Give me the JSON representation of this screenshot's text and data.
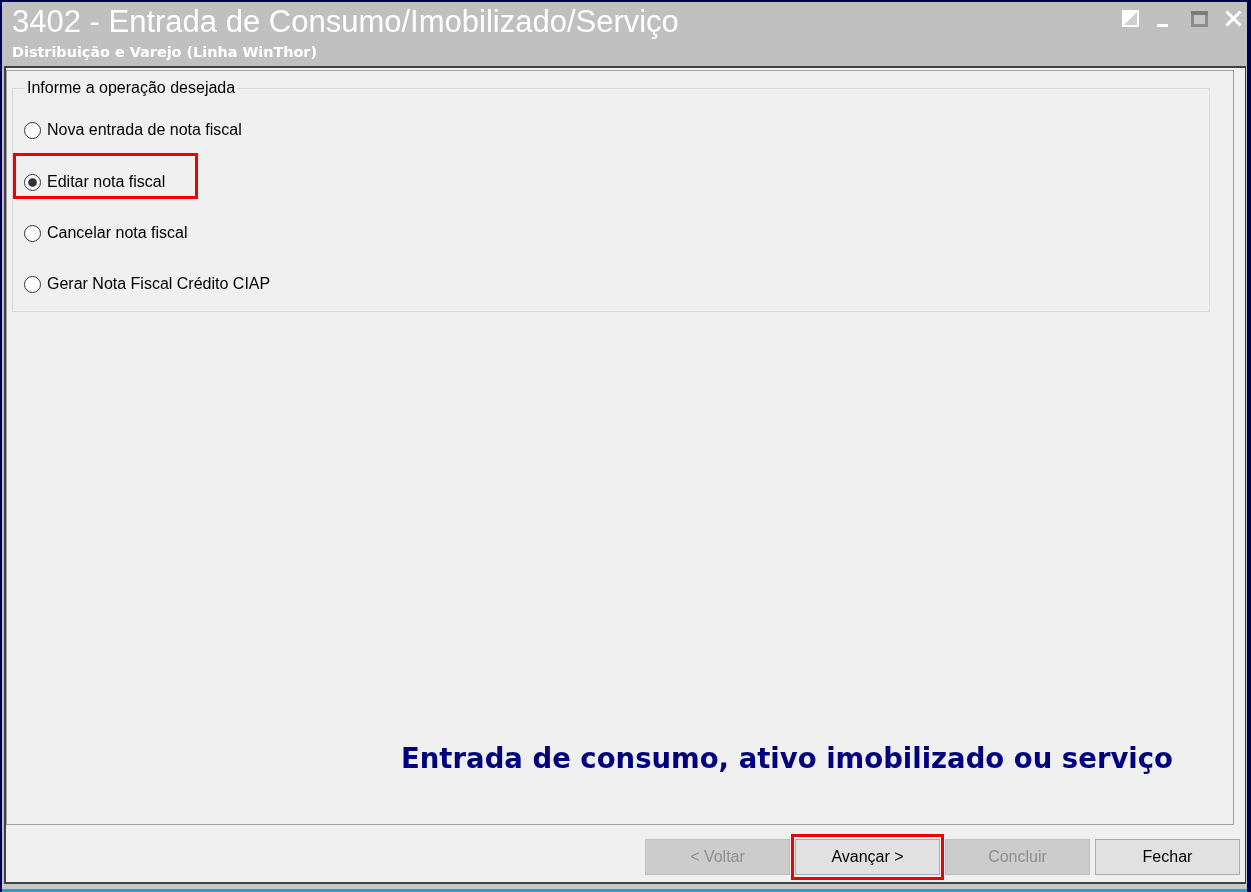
{
  "window": {
    "title": "3402 - Entrada de Consumo/Imobilizado/Serviço",
    "subtitle": "Distribuição e Varejo (Linha WinThor)"
  },
  "operation_group": {
    "legend": "Informe a operação desejada",
    "options": [
      {
        "label": "Nova entrada de nota fiscal",
        "selected": false,
        "highlighted": false
      },
      {
        "label": "Editar nota fiscal",
        "selected": true,
        "highlighted": true
      },
      {
        "label": "Cancelar nota fiscal",
        "selected": false,
        "highlighted": false
      },
      {
        "label": "Gerar Nota Fiscal Crédito CIAP",
        "selected": false,
        "highlighted": false
      }
    ]
  },
  "banner": {
    "text": "Entrada de consumo, ativo imobilizado ou serviço"
  },
  "buttons": [
    {
      "label": "< Voltar",
      "disabled": true,
      "highlighted": false
    },
    {
      "label": "Avançar >",
      "disabled": false,
      "highlighted": true
    },
    {
      "label": "Concluir",
      "disabled": true,
      "highlighted": false
    },
    {
      "label": "Fechar",
      "disabled": false,
      "highlighted": false
    }
  ]
}
